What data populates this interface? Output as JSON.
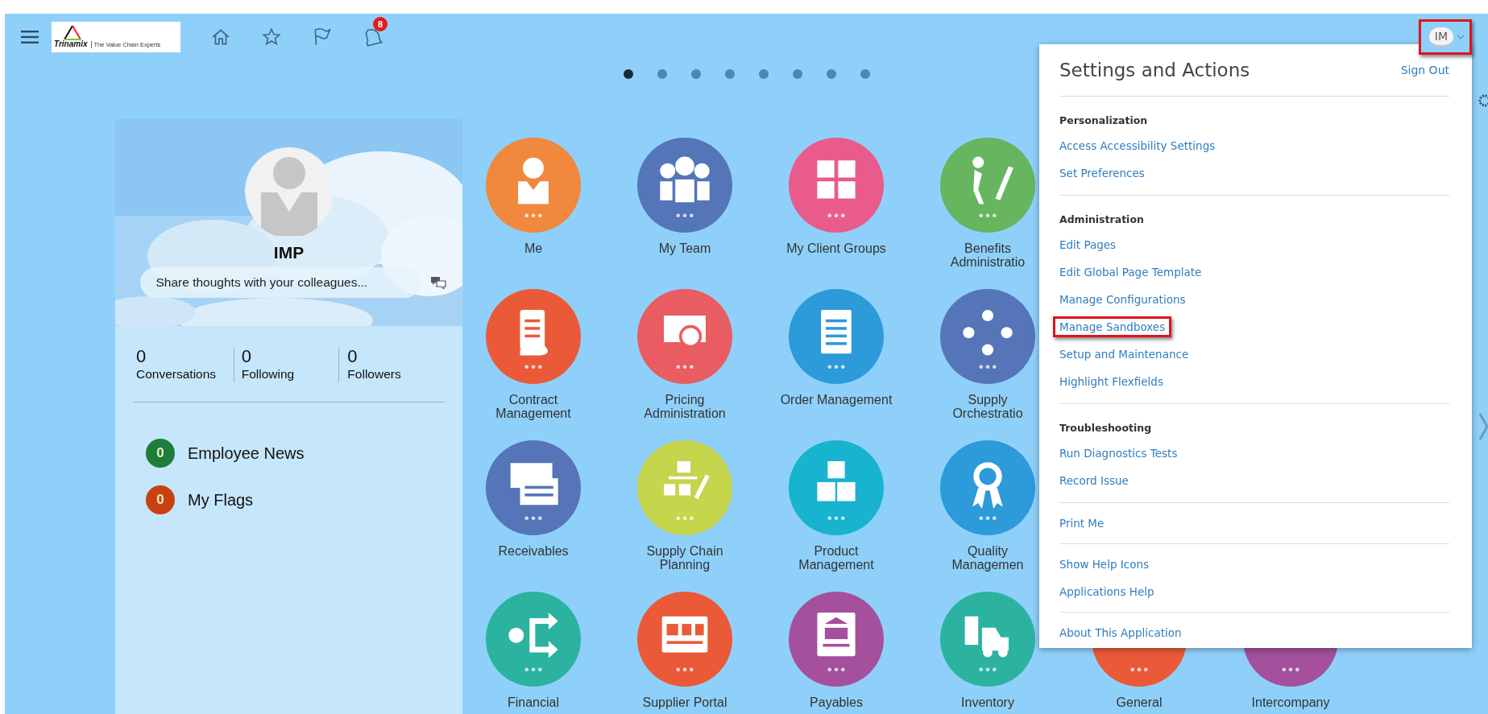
{
  "header": {
    "logo": {
      "name": "Trinamix",
      "tagline": "The Value Chain Experts"
    },
    "notifications": {
      "badge": "8"
    },
    "user": {
      "initials": "IM",
      "highlighted": true
    }
  },
  "page_dots": [
    {
      "selected": true
    },
    {
      "selected": false
    },
    {
      "selected": false
    },
    {
      "selected": false
    },
    {
      "selected": false
    },
    {
      "selected": false
    },
    {
      "selected": false
    },
    {
      "selected": false
    }
  ],
  "profile": {
    "name": "IMP",
    "share_field": {
      "placeholder": "Share thoughts with your colleagues..."
    },
    "stats": [
      {
        "value": "0",
        "label": "Conversations"
      },
      {
        "value": "0",
        "label": "Following"
      },
      {
        "value": "0",
        "label": "Followers"
      }
    ],
    "links": [
      {
        "count": "0",
        "label": "Employee News",
        "color": "#1e7d3a"
      },
      {
        "count": "0",
        "label": "My Flags",
        "color": "#c8410f"
      }
    ]
  },
  "apps": [
    [
      {
        "label": [
          "Me"
        ],
        "color": "#f0883e"
      },
      {
        "label": [
          "My Team"
        ],
        "color": "#5475b8"
      },
      {
        "label": [
          "My Client Groups"
        ],
        "color": "#e95b8a"
      },
      {
        "label": [
          "Benefits",
          "Administratio"
        ],
        "color": "#67b55e"
      }
    ],
    [
      {
        "label": [
          "Contract",
          "Management"
        ],
        "color": "#ea5a38"
      },
      {
        "label": [
          "Pricing",
          "Administration"
        ],
        "color": "#e85c62"
      },
      {
        "label": [
          "Order Management"
        ],
        "color": "#2d9ad9"
      },
      {
        "label": [
          "Supply",
          "Orchestratio"
        ],
        "color": "#5575b8"
      }
    ],
    [
      {
        "label": [
          "Receivables"
        ],
        "color": "#5575b8"
      },
      {
        "label": [
          "Supply Chain",
          "Planning"
        ],
        "color": "#c5d54c"
      },
      {
        "label": [
          "Product",
          "Management"
        ],
        "color": "#17b3cf"
      },
      {
        "label": [
          "Quality",
          "Managemen"
        ],
        "color": "#2d9ad9"
      }
    ],
    [
      {
        "label": [
          "Financial"
        ],
        "color": "#2bb3a0"
      },
      {
        "label": [
          "Supplier Portal"
        ],
        "color": "#ea5a38"
      },
      {
        "label": [
          "Payables"
        ],
        "color": "#a4509d"
      },
      {
        "label": [
          "Inventory"
        ],
        "color": "#2bb3a0"
      },
      {
        "label": [
          "General"
        ],
        "color": "#ea5a38"
      },
      {
        "label": [
          "Intercompany"
        ],
        "color": "#a4509d"
      }
    ]
  ],
  "settings_menu": {
    "title": "Settings and Actions",
    "sign_out": "Sign Out",
    "sections": [
      {
        "heading": "Personalization",
        "items": [
          {
            "label": "Access Accessibility Settings",
            "highlighted": false
          },
          {
            "label": "Set Preferences",
            "highlighted": false
          }
        ]
      },
      {
        "heading": "Administration",
        "items": [
          {
            "label": "Edit Pages",
            "highlighted": false
          },
          {
            "label": "Edit Global Page Template",
            "highlighted": false
          },
          {
            "label": "Manage Configurations",
            "highlighted": false
          },
          {
            "label": "Manage Sandboxes",
            "highlighted": true
          },
          {
            "label": "Setup and Maintenance",
            "highlighted": false
          },
          {
            "label": "Highlight Flexfields",
            "highlighted": false
          }
        ]
      },
      {
        "heading": "Troubleshooting",
        "items": [
          {
            "label": "Run Diagnostics Tests",
            "highlighted": false
          },
          {
            "label": "Record Issue",
            "highlighted": false
          }
        ]
      },
      {
        "items": [
          {
            "label": "Print Me",
            "highlighted": false
          }
        ]
      },
      {
        "items": [
          {
            "label": "Show Help Icons",
            "highlighted": false
          },
          {
            "label": "Applications Help",
            "highlighted": false
          }
        ]
      },
      {
        "items": [
          {
            "label": "About This Application",
            "highlighted": false
          }
        ]
      }
    ]
  }
}
